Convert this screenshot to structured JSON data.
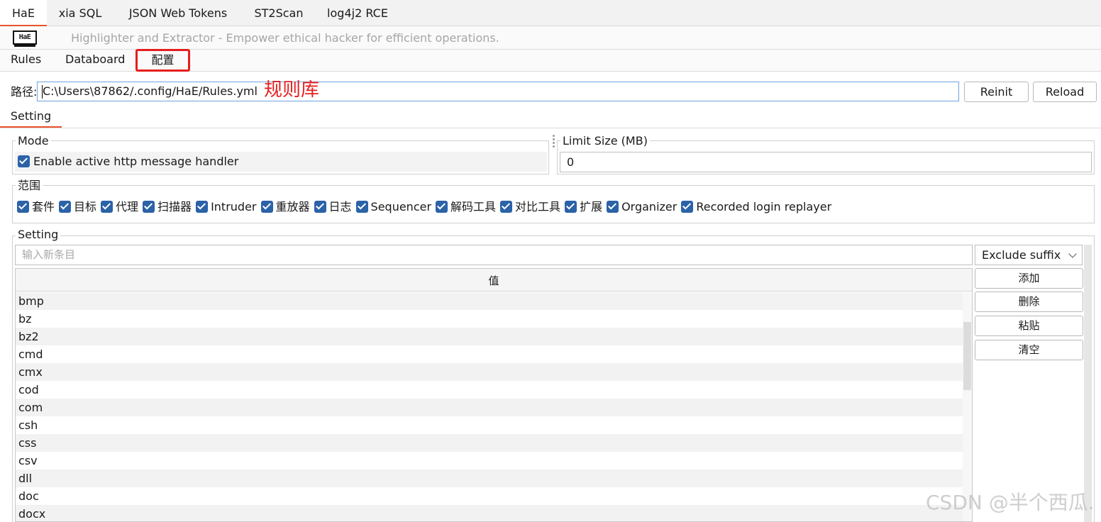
{
  "tabs": [
    "HaE",
    "xia SQL",
    "JSON Web Tokens",
    "ST2Scan",
    "log4j2 RCE"
  ],
  "header": {
    "logo_text": "HaE",
    "tagline": "Highlighter and Extractor - Empower ethical hacker for efficient operations."
  },
  "subtabs": [
    "Rules",
    "Databoard",
    "配置"
  ],
  "path": {
    "label": "路径:",
    "value": "C:\\Users\\87862/.config/HaE/Rules.yml",
    "annotation": "规则库",
    "reinit": "Reinit",
    "reload": "Reload"
  },
  "setting_tab": "Setting",
  "mode": {
    "title": "Mode",
    "option": "Enable active http message handler",
    "checked": true
  },
  "limit": {
    "title": "Limit Size (MB)",
    "value": "0"
  },
  "scope": {
    "title": "范围",
    "items": [
      "套件",
      "目标",
      "代理",
      "扫描器",
      "Intruder",
      "重放器",
      "日志",
      "Sequencer",
      "解码工具",
      "对比工具",
      "扩展",
      "Organizer",
      "Recorded login replayer"
    ]
  },
  "setting": {
    "title": "Setting",
    "input_placeholder": "输入新条目",
    "select_value": "Exclude suffix",
    "column_header": "值",
    "rows": [
      "bmp",
      "bz",
      "bz2",
      "cmd",
      "cmx",
      "cod",
      "com",
      "csh",
      "css",
      "csv",
      "dll",
      "doc",
      "docx"
    ],
    "buttons": {
      "add": "添加",
      "delete": "删除",
      "paste": "粘贴",
      "clear": "清空"
    }
  },
  "watermark": "CSDN @半个西瓜.",
  "colors": {
    "accent": "#e8532c",
    "annotation": "#e51e1e",
    "checkbox": "#2b62a8",
    "input_focus": "#6fa3e0"
  }
}
